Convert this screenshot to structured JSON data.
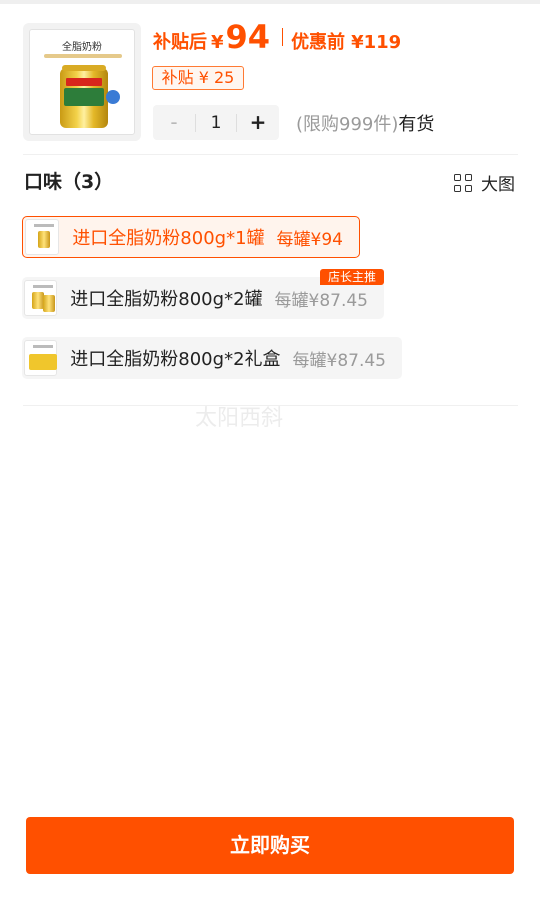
{
  "product": {
    "thumb_title": "全脂奶粉",
    "subsidy_label": "补贴后",
    "currency": "¥",
    "price": "94",
    "original_label": "优惠前",
    "original_price": "¥119",
    "subsidy_tag": "补贴 ¥ 25"
  },
  "quantity": {
    "minus": "-",
    "value": "1",
    "plus": "+",
    "limit_text": "(限购999件)",
    "stock_text": "有货"
  },
  "flavor": {
    "title": "口味（3）",
    "view_toggle": "大图",
    "options": [
      {
        "name": "进口全脂奶粉800g*1罐",
        "per_price": "每罐¥94",
        "selected": true
      },
      {
        "name": "进口全脂奶粉800g*2罐",
        "per_price": "每罐¥87.45",
        "badge": "店长主推"
      },
      {
        "name": "进口全脂奶粉800g*2礼盒",
        "per_price": "每罐¥87.45"
      }
    ]
  },
  "watermark": "太阳西斜",
  "buy_button": "立即购买",
  "colors": {
    "accent": "#ff5000",
    "muted": "#9a9a9a"
  },
  "icons": {
    "view_toggle": "grid-icon"
  }
}
